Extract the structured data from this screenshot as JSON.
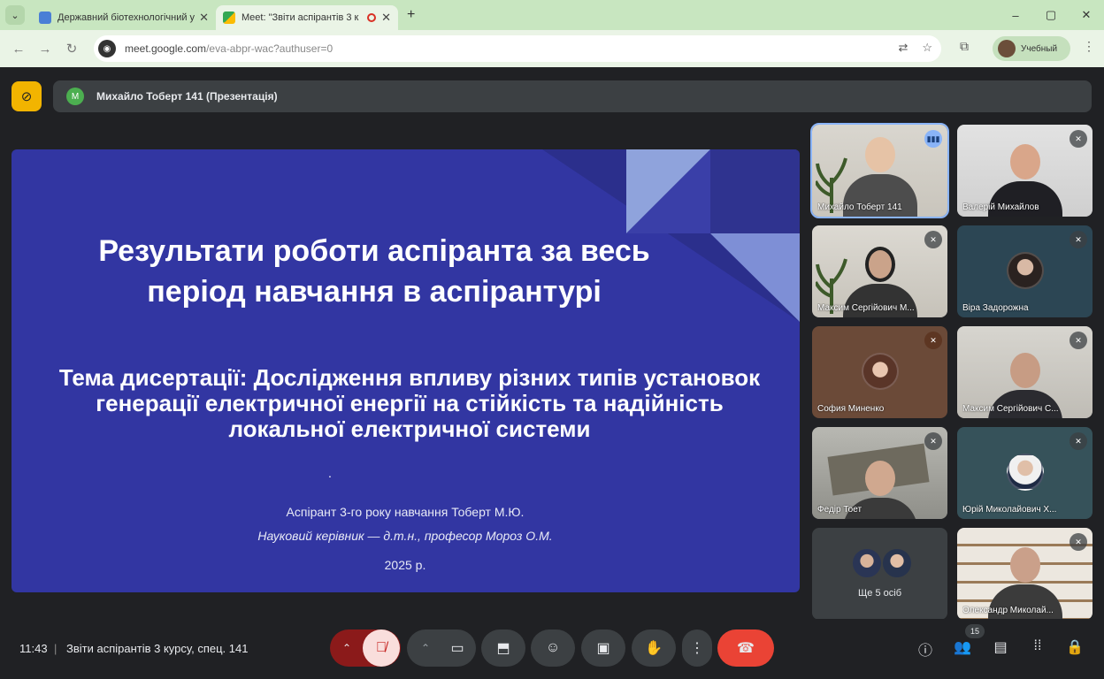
{
  "browser": {
    "tabs": [
      {
        "title": "Державний біотехнологічний у",
        "active": false
      },
      {
        "title": "Meet: \"Звіти аспірантів 3 к",
        "active": true
      }
    ],
    "new_tab_symbol": "+",
    "url_host": "meet.google.com",
    "url_path": "/eva-abpr-wac?authuser=0",
    "profile_label": "Учебный",
    "window_controls": [
      "–",
      "▢",
      "✕"
    ]
  },
  "meet": {
    "presenter_initial": "M",
    "presenter_name": "Михайло Тоберт 141 (Презентація)",
    "slide": {
      "title": "Результати роботи аспіранта за весь період навчання в аспірантурі",
      "topic": "Тема дисертації: Дослідження впливу різних типів установок генерації електричної енергії на стійкість та надійність локальної електричної системи",
      "dot": ".",
      "author": "Аспірант 3-го року навчання Тоберт М.Ю.",
      "supervisor": "Науковий керівник — д.т.н., професор Мороз О.М.",
      "year": "2025 р."
    },
    "participants": [
      {
        "name": "Михайло Тоберт 141",
        "speaking": true
      },
      {
        "name": "Валерій Михайлов",
        "muted": true
      },
      {
        "name": "Максим Сергійович М...",
        "muted": true
      },
      {
        "name": "Віра Задорожна",
        "muted": true
      },
      {
        "name": "София Миненко",
        "muted": true
      },
      {
        "name": "Максим Сергійович С...",
        "muted": true
      },
      {
        "name": "Федір Тоет",
        "muted": true
      },
      {
        "name": "Юрій Миколайович Х...",
        "muted": true
      },
      {
        "name": "Олександр Миколай...",
        "muted": true
      }
    ],
    "more_label": "Ще 5 осіб",
    "bottom": {
      "time": "11:43",
      "separator": "|",
      "meeting_title": "Звіти аспірантів 3 курсу, спец. 141",
      "participant_count": "15"
    },
    "colors": {
      "slide_bg": "#3236a2",
      "end_call": "#ea4335",
      "tab_bar": "#c8e6c0"
    }
  }
}
